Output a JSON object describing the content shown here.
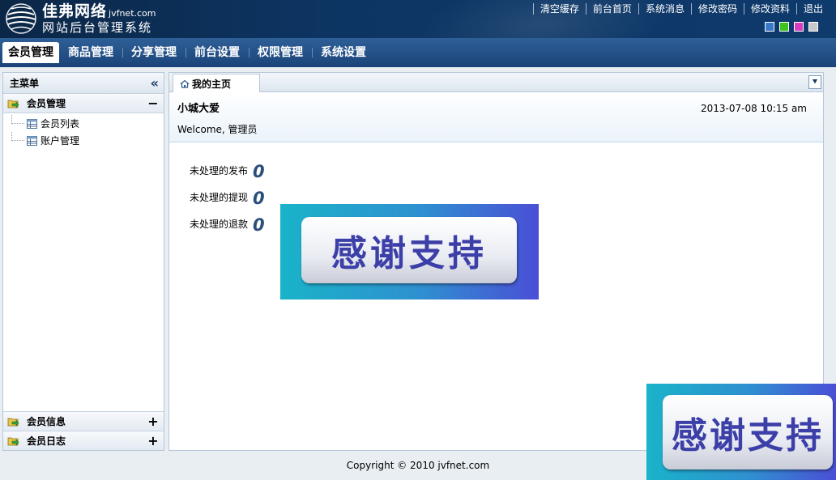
{
  "header": {
    "logo_name": "佳弗网络",
    "logo_domain": "jvfnet.com",
    "logo_subtitle": "网站后台管理系统",
    "links": [
      "清空缓存",
      "前台首页",
      "系统消息",
      "修改密码",
      "修改资料",
      "退出"
    ],
    "skins": [
      {
        "name": "skin-blue",
        "color": "#3a78c9"
      },
      {
        "name": "skin-green",
        "color": "#3fc21f"
      },
      {
        "name": "skin-magenta",
        "color": "#d93dbf"
      },
      {
        "name": "skin-gray",
        "color": "#c8c8c8"
      }
    ]
  },
  "nav": {
    "items": [
      "会员管理",
      "商品管理",
      "分享管理",
      "前台设置",
      "权限管理",
      "系统设置"
    ],
    "active": "会员管理"
  },
  "sidebar": {
    "title": "主菜单",
    "groups": [
      {
        "label": "会员管理",
        "toggle": "−",
        "items": [
          "会员列表",
          "账户管理"
        ]
      },
      {
        "label": "会员信息",
        "toggle": "+"
      },
      {
        "label": "会员日志",
        "toggle": "+"
      }
    ]
  },
  "main": {
    "tab_label": "我的主页",
    "user_name": "小城大爱",
    "datetime": "2013-07-08 10:15 am",
    "welcome_text": "Welcome, 管理员",
    "stats": [
      {
        "label": "未处理的发布",
        "value": "0"
      },
      {
        "label": "未处理的提现",
        "value": "0"
      },
      {
        "label": "未处理的退款",
        "value": "0"
      }
    ],
    "thanks_text": "感谢支持"
  },
  "footer": {
    "copyright": "Copyright © 2010 jvfnet.com"
  }
}
